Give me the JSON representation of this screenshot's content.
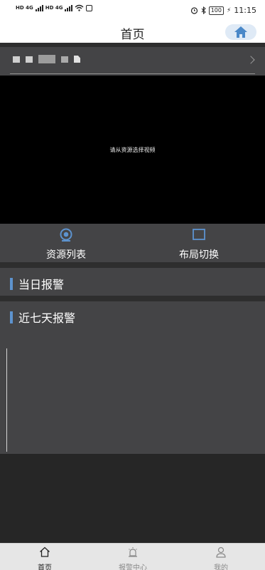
{
  "status_bar": {
    "network_a": "HD 4G",
    "network_b": "HD 4G",
    "battery": "100",
    "time": "11:15"
  },
  "header": {
    "title": "首页"
  },
  "video": {
    "placeholder": "请从资源选择视频"
  },
  "actions": [
    {
      "label": "资源列表",
      "icon": "camera-icon"
    },
    {
      "label": "布局切换",
      "icon": "layout-icon"
    }
  ],
  "sections": {
    "today_alarm": "当日报警",
    "seven_day_alarm": "近七天报警"
  },
  "tabs": [
    {
      "label": "首页",
      "icon": "home-icon",
      "active": true
    },
    {
      "label": "报警中心",
      "icon": "alarm-icon",
      "active": false
    },
    {
      "label": "我的",
      "icon": "user-icon",
      "active": false
    }
  ],
  "colors": {
    "accent": "#5d93cf",
    "panel": "#444446",
    "background": "#262626",
    "tab_active": "#222222",
    "tab_inactive": "#8a8a8a"
  }
}
